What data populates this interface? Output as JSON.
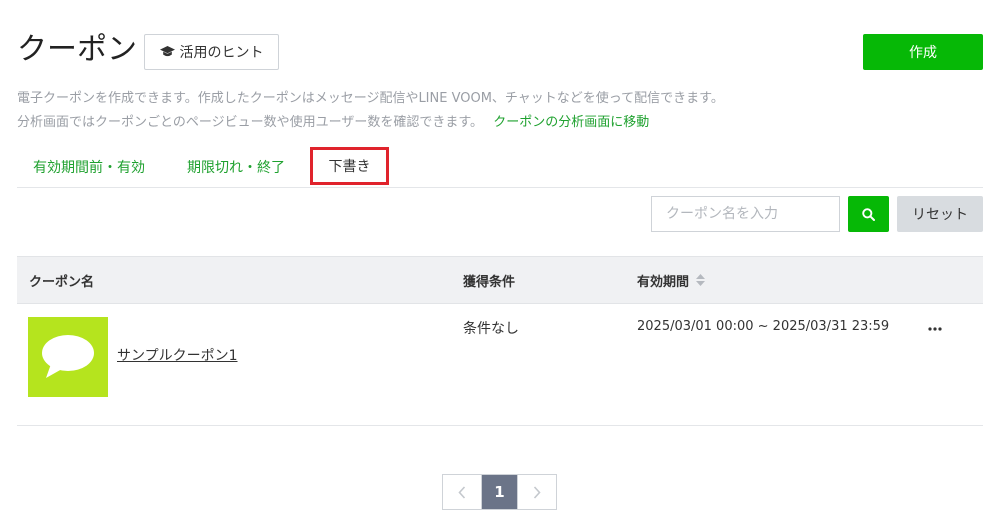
{
  "header": {
    "title": "クーポン",
    "hint_label": "活用のヒント",
    "create_label": "作成"
  },
  "description": {
    "line1": "電子クーポンを作成できます。作成したクーポンはメッセージ配信やLINE VOOM、チャットなどを使って配信できます。",
    "line2": "分析画面ではクーポンごとのページビュー数や使用ユーザー数を確認できます。",
    "analytics_link": "クーポンの分析画面に移動"
  },
  "tabs": [
    {
      "label": "有効期間前・有効",
      "active": false
    },
    {
      "label": "期限切れ・終了",
      "active": false
    },
    {
      "label": "下書き",
      "active": true
    }
  ],
  "search": {
    "placeholder": "クーポン名を入力",
    "value": "",
    "reset_label": "リセット"
  },
  "table": {
    "columns": [
      "クーポン名",
      "獲得条件",
      "有効期間"
    ],
    "rows": [
      {
        "name": "サンプルクーポン1",
        "condition": "条件なし",
        "period": "2025/03/01 00:00 ~ 2025/03/31 23:59"
      }
    ]
  },
  "pagination": {
    "current": "1"
  },
  "colors": {
    "brand_green": "#06b806",
    "link_green": "#1fa12f",
    "highlight_red": "#e0232c",
    "thumb_lime": "#b5e41e",
    "page_active": "#6b7488"
  },
  "icons": {
    "hint": "graduation-cap-icon",
    "search": "search-icon",
    "sort": "sort-icon",
    "more": "ellipsis-icon",
    "thumb": "speech-bubble-icon",
    "prev": "chevron-left-icon",
    "next": "chevron-right-icon"
  }
}
